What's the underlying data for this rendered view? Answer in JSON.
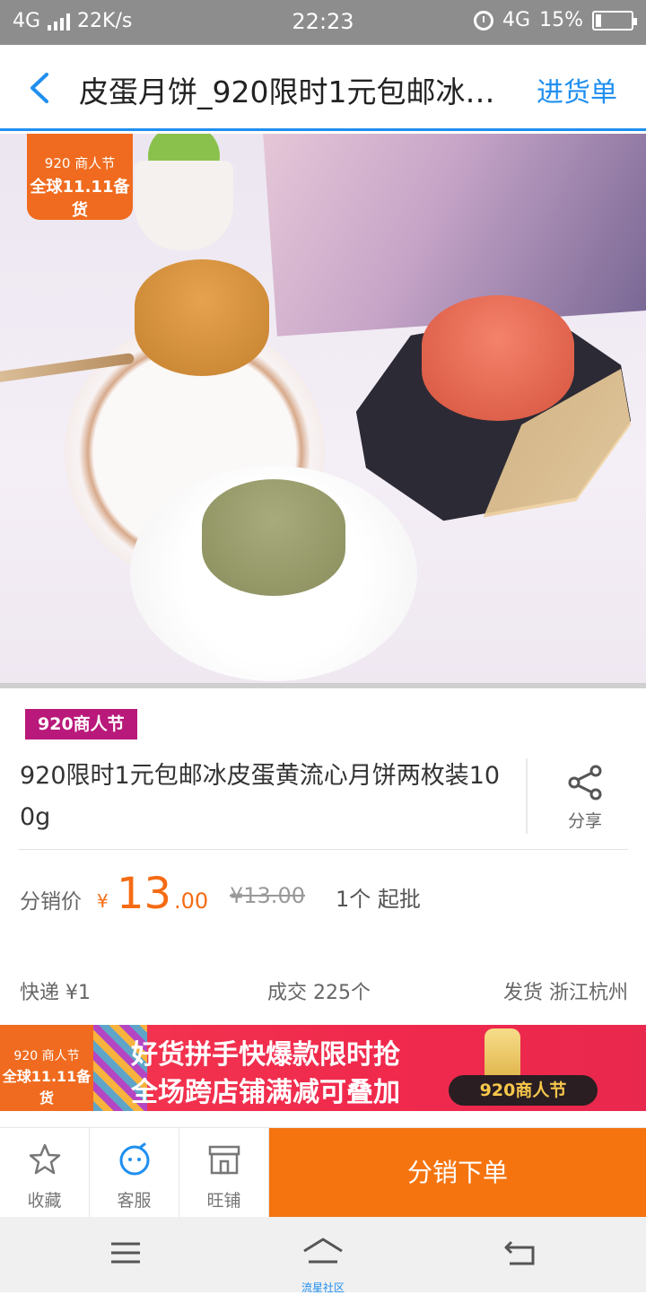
{
  "status_bar": {
    "network_left": "4G",
    "speed": "22K/s",
    "time": "22:23",
    "network_right": "4G",
    "battery": "15%"
  },
  "header": {
    "title": "皮蛋月饼_920限时1元包邮冰…",
    "cart_label": "进货单",
    "accent_color": "#1f8ff0"
  },
  "hero": {
    "badge_line1": "920 商人节",
    "badge_line2": "全球11.11备货"
  },
  "product": {
    "tag": "920商人节",
    "title": "920限时1元包邮冰皮蛋黄流心月饼两枚装100g",
    "share_label": "分享"
  },
  "price": {
    "label": "分销价",
    "currency": "¥",
    "integer": "13",
    "decimal": ".00",
    "original": "¥13.00",
    "moq": "1个 起批",
    "color": "#f56b14"
  },
  "meta": {
    "shipping": "快递  ¥1",
    "deals": "成交  225个",
    "origin": "发货  浙江杭州"
  },
  "banner": {
    "badge_line1": "920 商人节",
    "badge_line2": "全球11.11备货",
    "line1": "好货拼手快爆款限时抢",
    "line2": "全场跨店铺满减可叠加",
    "pill": "920商人节"
  },
  "actions": {
    "favorite": "收藏",
    "service": "客服",
    "shop": "旺铺",
    "order": "分销下单",
    "order_color": "#f5740f"
  },
  "navbar": {
    "home_label": "流星社区"
  }
}
